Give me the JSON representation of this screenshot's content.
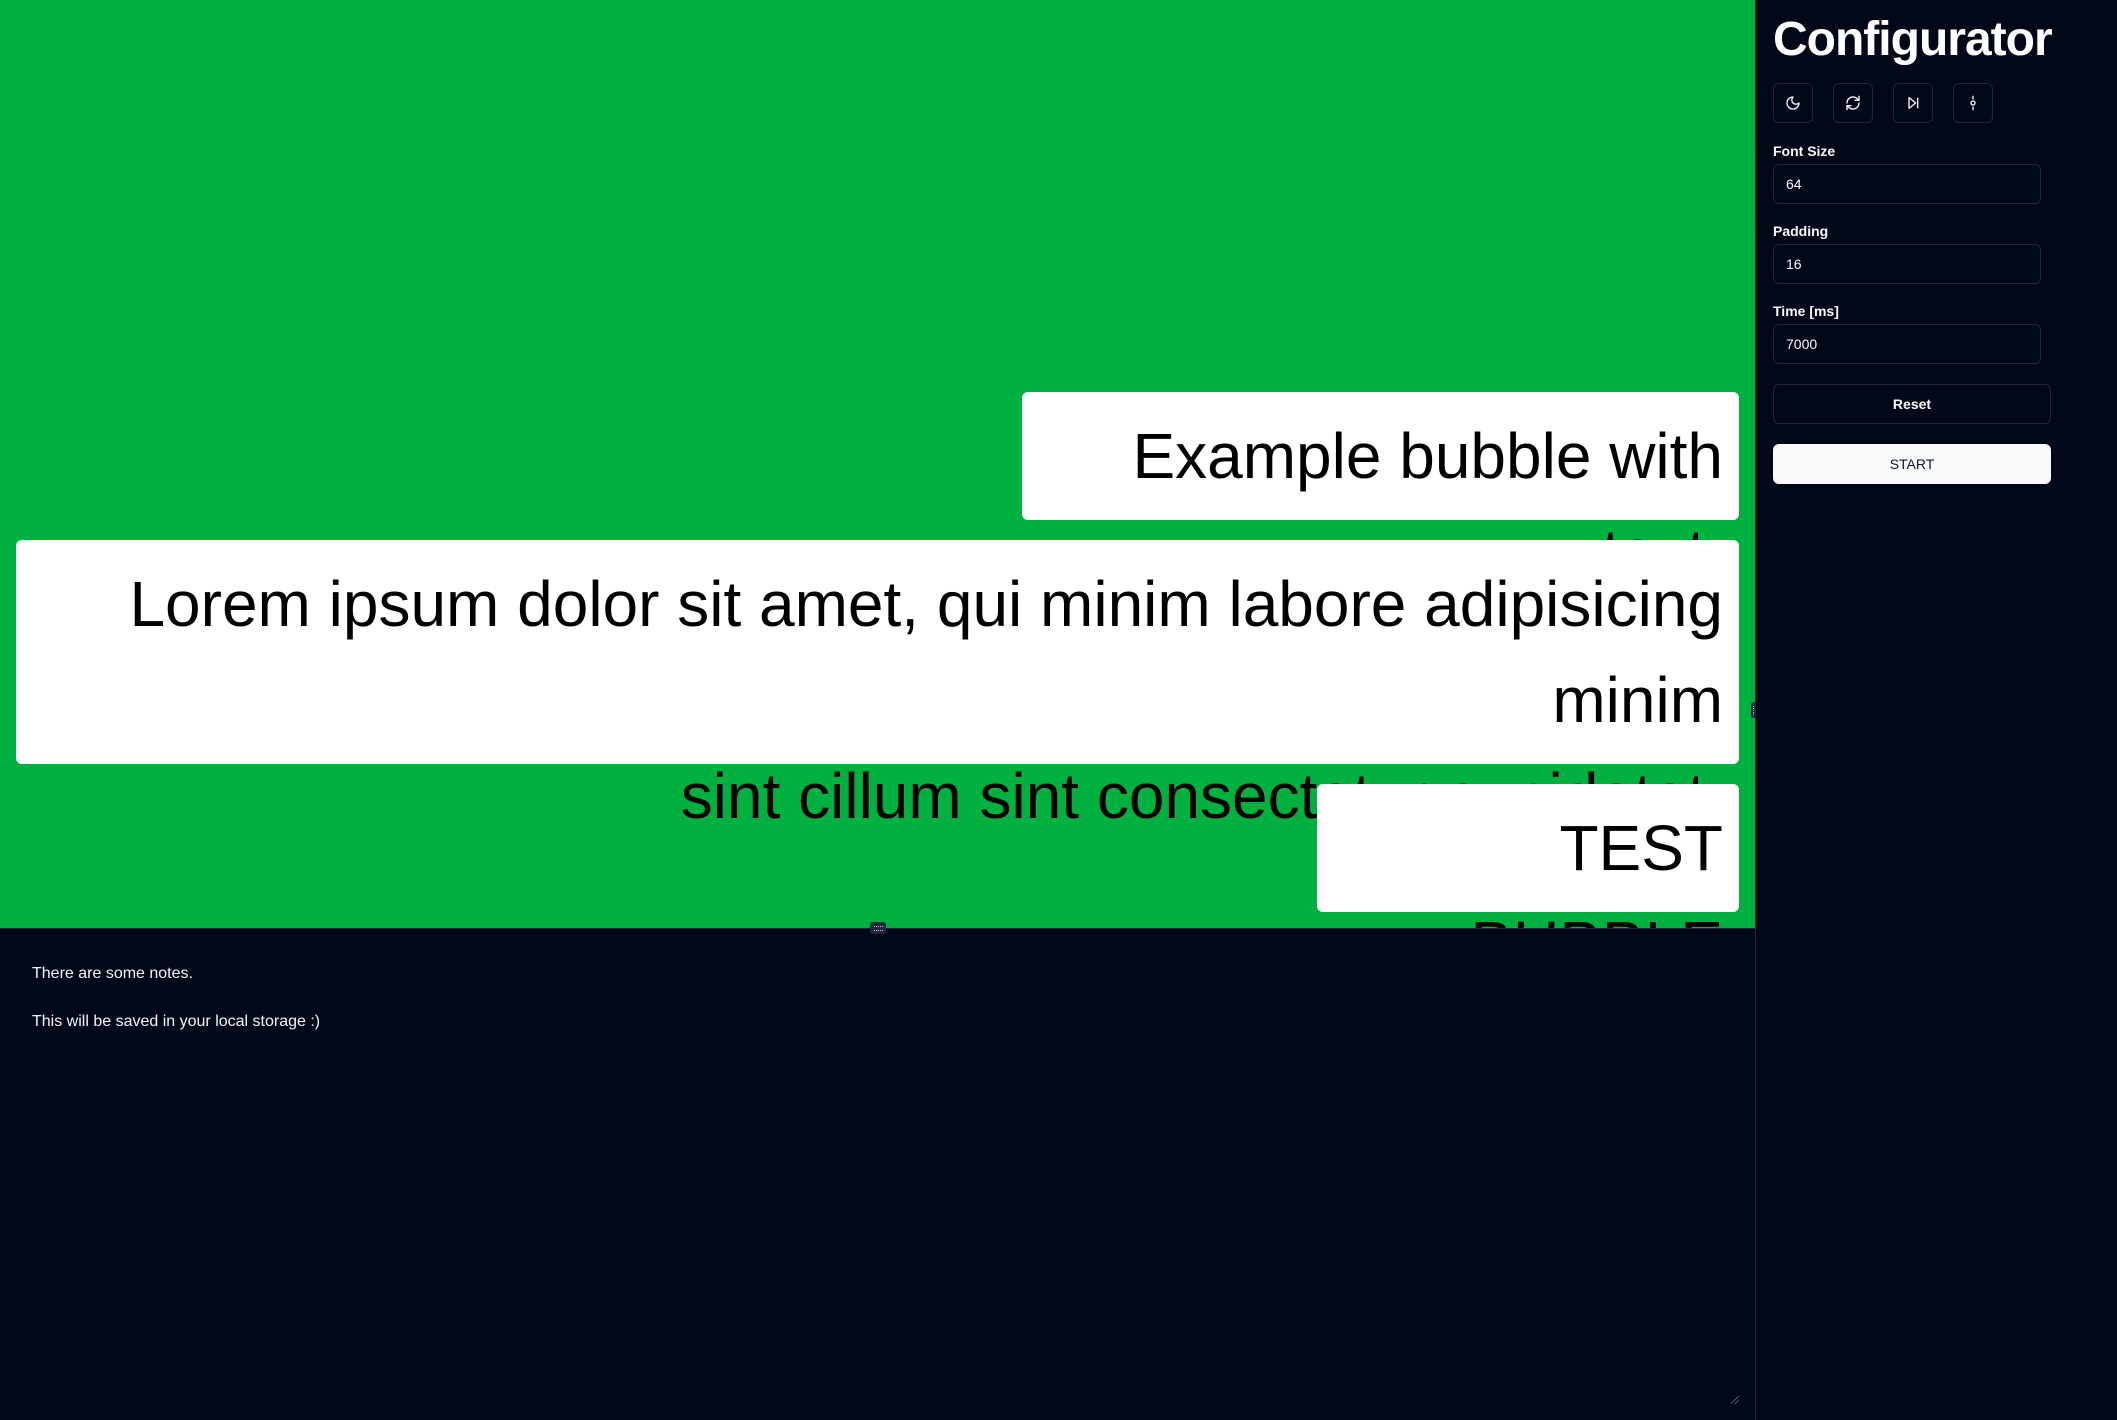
{
  "preview": {
    "background_color": "#00b140",
    "bubbles": [
      {
        "text": "Example bubble with text."
      },
      {
        "line1": "Lorem ipsum dolor sit amet, qui minim labore adipisicing minim",
        "line2": "sint cillum sint consectetur cupidatat."
      },
      {
        "text": "TEST BUBBLE"
      }
    ]
  },
  "notes": {
    "line1": "There are some notes.",
    "line2": "This will be saved in your local storage :)"
  },
  "sidebar": {
    "title": "Configurator",
    "icons": [
      "moon-icon",
      "refresh-icon",
      "skip-forward-icon",
      "settings-icon"
    ],
    "font_size": {
      "label": "Font Size",
      "value": "64"
    },
    "padding": {
      "label": "Padding",
      "value": "16"
    },
    "time": {
      "label": "Time [ms]",
      "value": "7000"
    },
    "reset_label": "Reset",
    "start_label": "START"
  }
}
